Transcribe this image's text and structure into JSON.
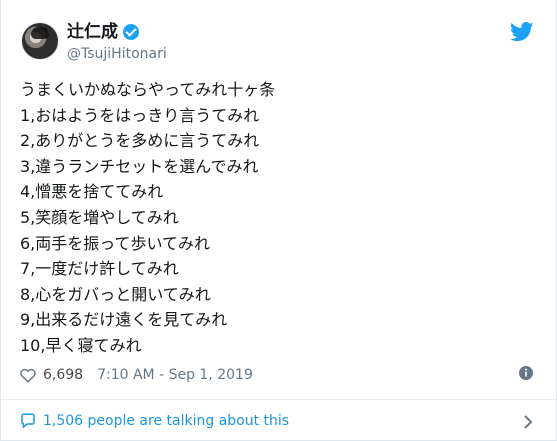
{
  "profile": {
    "display_name": "辻仁成",
    "handle": "@TsujiHitonari",
    "verified": true
  },
  "tweet": {
    "text": "うまくいかぬならやってみれ十ヶ条\n1,おはようをはっきり言うてみれ\n2,ありがとうを多めに言うてみれ\n3,違うランチセットを選んでみれ\n4,憎悪を捨ててみれ\n5,笑顔を増やしてみれ\n6,両手を振って歩いてみれ\n7,一度だけ許してみれ\n8,心をガバっと開いてみれ\n9,出来るだけ遠くを見てみれ\n10,早く寝てみれ",
    "likes": "6,698",
    "timestamp": "7:10 AM - Sep 1, 2019",
    "conversation": "1,506 people are talking about this"
  },
  "colors": {
    "brand": "#1da1f2",
    "text": "#14171a",
    "muted": "#657786",
    "link": "#1b95e0",
    "border": "#e6ecf0"
  },
  "icons": {
    "logo": "twitter-logo-icon",
    "verified": "verified-badge-icon",
    "like": "heart-icon",
    "info": "info-icon",
    "conversation": "speech-bubble-icon",
    "chevron": "chevron-right-icon"
  }
}
